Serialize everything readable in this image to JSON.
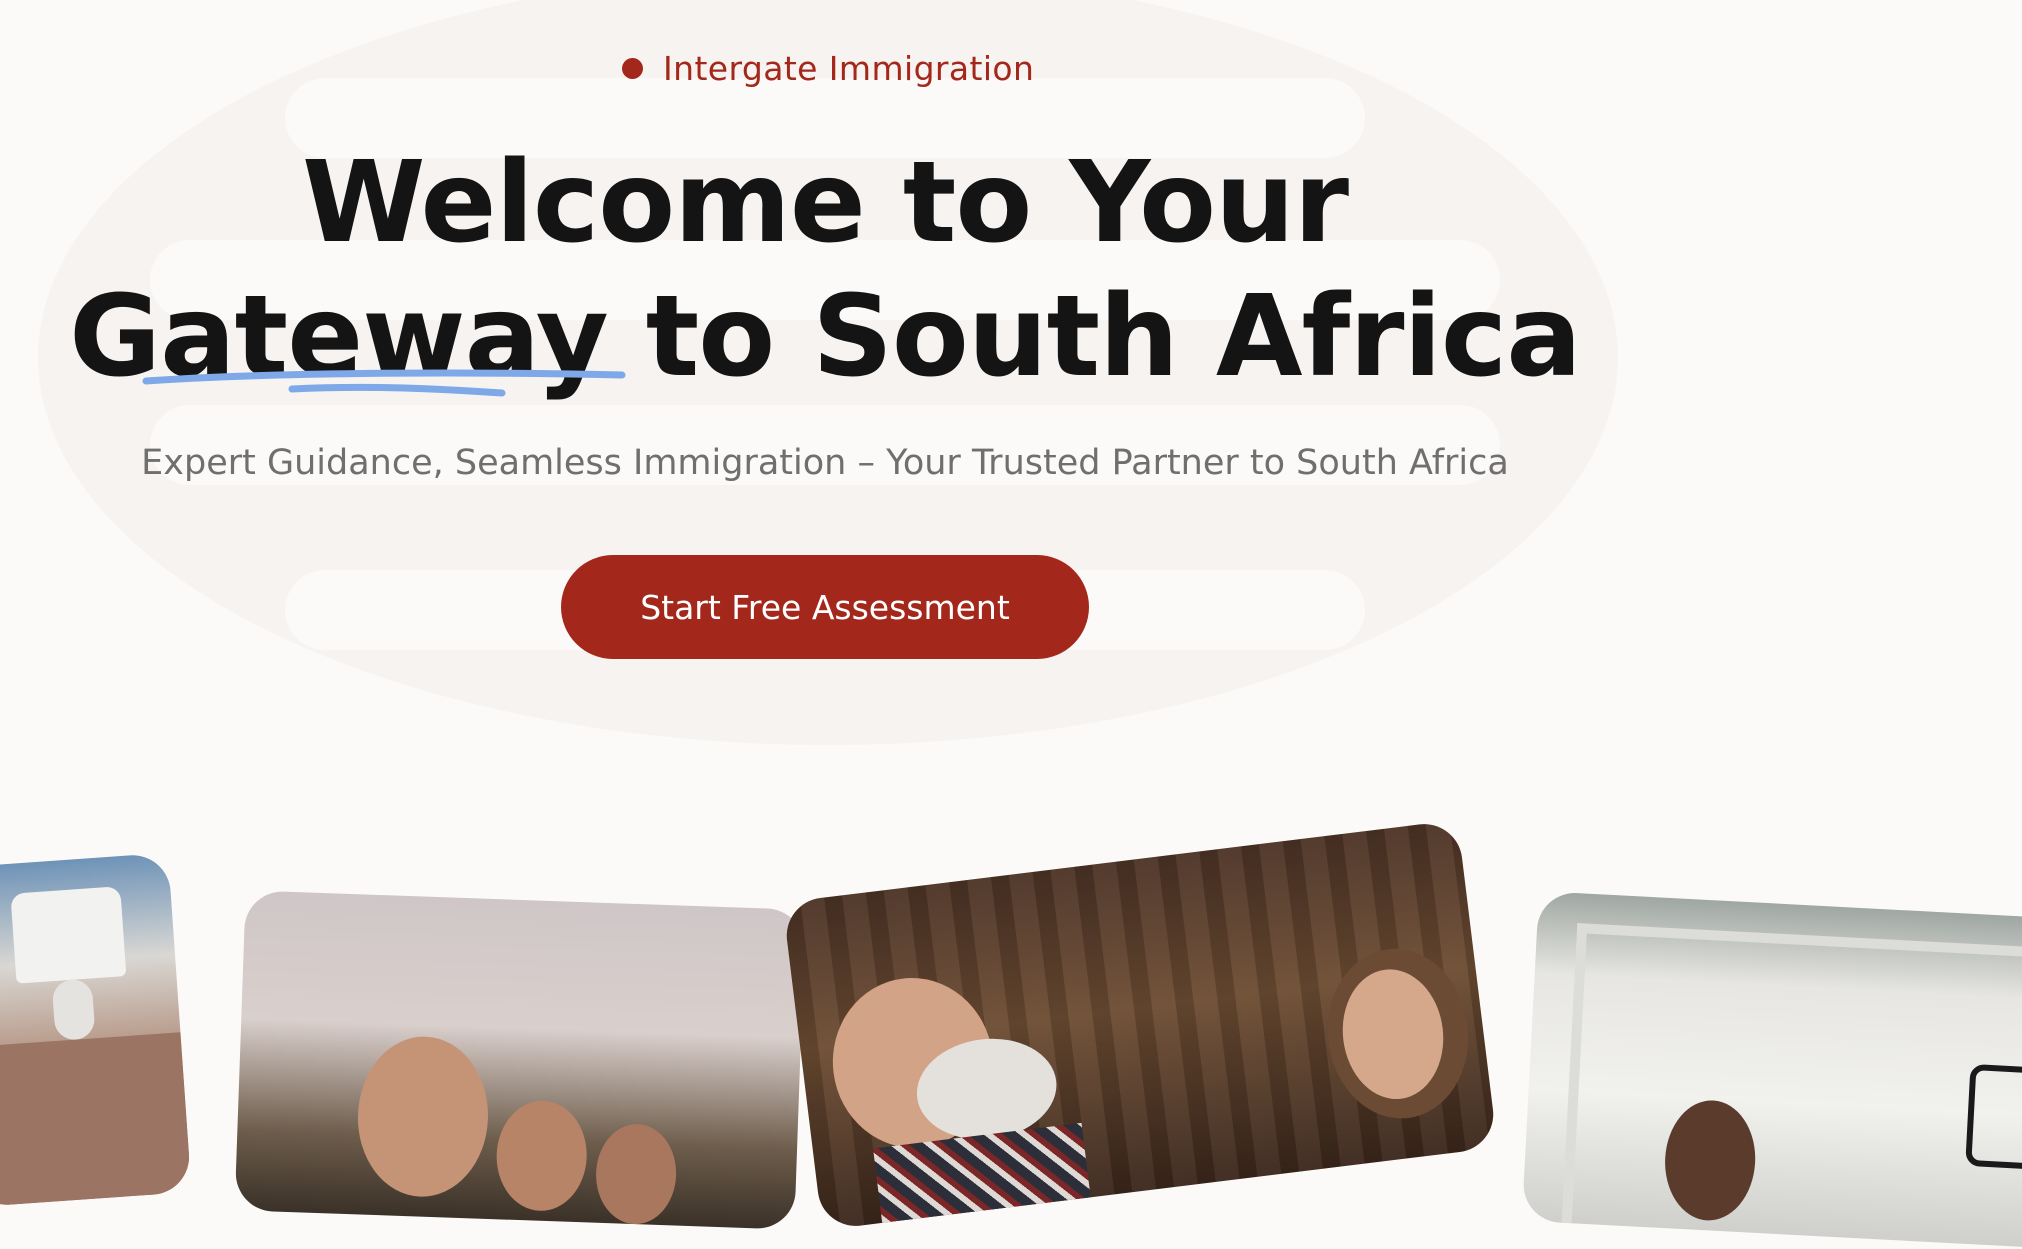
{
  "hero": {
    "eyebrow": "Intergate Immigration",
    "headline_line1": "Welcome to Your",
    "headline_line2": "Gateway to South Africa",
    "subheadline": "Expert Guidance, Seamless Immigration – Your Trusted Partner to South Africa",
    "cta_label": "Start Free Assessment"
  },
  "colors": {
    "accent": "#a3281b",
    "background": "#fcfaf8",
    "heading": "#141414",
    "subtext": "#6f6f6f",
    "underline": "#7ea8e8"
  },
  "icons": {
    "eyebrow_marker": "dot-icon",
    "headline_accent": "scribble-underline-icon"
  },
  "gallery": {
    "photos": [
      "photo-living-room",
      "photo-family-outdoors",
      "photo-laughing-couple",
      "photo-office-meeting"
    ]
  }
}
